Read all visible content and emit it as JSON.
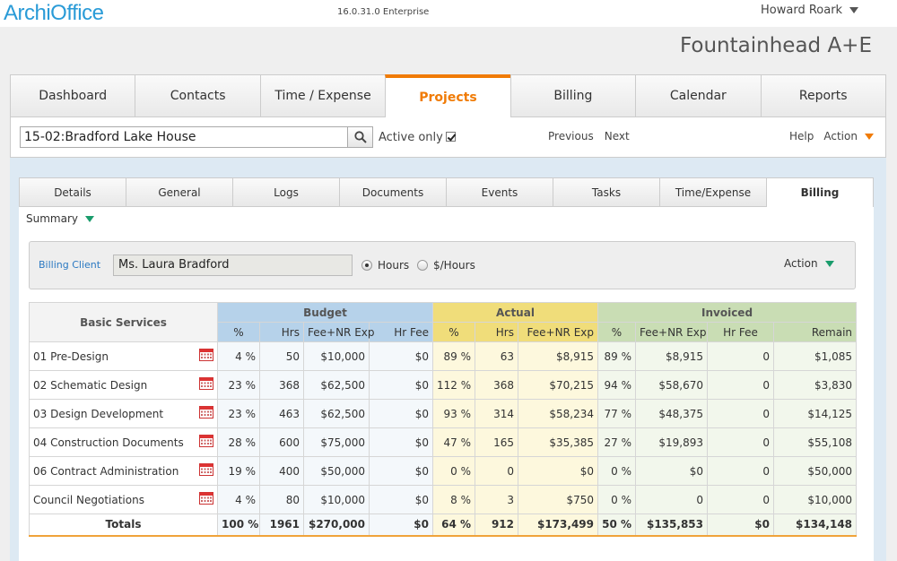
{
  "header": {
    "logo": "ArchiOffice",
    "version": "16.0.31.0 Enterprise",
    "user": "Howard Roark",
    "firm": "Fountainhead A+E"
  },
  "main_tabs": [
    "Dashboard",
    "Contacts",
    "Time / Expense",
    "Projects",
    "Billing",
    "Calendar",
    "Reports"
  ],
  "project_bar": {
    "project_value": "15-02:Bradford Lake House",
    "active_only_label": "Active only",
    "previous_label": "Previous",
    "next_label": "Next",
    "help_label": "Help",
    "action_label": "Action"
  },
  "sub_tabs": [
    "Details",
    "General",
    "Logs",
    "Documents",
    "Events",
    "Tasks",
    "Time/Expense",
    "Billing"
  ],
  "summary_label": "Summary",
  "client": {
    "label": "Billing Client",
    "value": "Ms. Laura Bradford",
    "hours_label": "Hours",
    "rate_label": "$/Hours",
    "action_label": "Action"
  },
  "table": {
    "col_basic": "Basic Services",
    "group_budget": "Budget",
    "group_actual": "Actual",
    "group_invoiced": "Invoiced",
    "sub_headers": [
      "%",
      "Hrs",
      "Fee+NR Exp",
      "Hr Fee",
      "%",
      "Hrs",
      "Fee+NR Exp",
      "%",
      "Fee+NR Exp",
      "Hr Fee",
      "Remain"
    ],
    "rows": [
      {
        "name": "01 Pre-Design",
        "cells": [
          "4 %",
          "50",
          "$10,000",
          "$0",
          "89 %",
          "63",
          "$8,915",
          "89 %",
          "$8,915",
          "0",
          "$1,085"
        ]
      },
      {
        "name": "02 Schematic Design",
        "cells": [
          "23 %",
          "368",
          "$62,500",
          "$0",
          "112 %",
          "368",
          "$70,215",
          "94 %",
          "$58,670",
          "0",
          "$3,830"
        ]
      },
      {
        "name": "03 Design Development",
        "cells": [
          "23 %",
          "463",
          "$62,500",
          "$0",
          "93 %",
          "314",
          "$58,234",
          "77 %",
          "$48,375",
          "0",
          "$14,125"
        ]
      },
      {
        "name": "04 Construction Documents",
        "cells": [
          "28 %",
          "600",
          "$75,000",
          "$0",
          "47 %",
          "165",
          "$35,385",
          "27 %",
          "$19,893",
          "0",
          "$55,108"
        ]
      },
      {
        "name": "06 Contract Administration",
        "cells": [
          "19 %",
          "400",
          "$50,000",
          "$0",
          "0 %",
          "0",
          "$0",
          "0 %",
          "$0",
          "0",
          "$50,000"
        ]
      },
      {
        "name": "Council Negotiations",
        "cells": [
          "4 %",
          "80",
          "$10,000",
          "$0",
          "8 %",
          "3",
          "$750",
          "0 %",
          "0",
          "0",
          "$10,000"
        ]
      }
    ],
    "totals": {
      "name": "Totals",
      "cells": [
        "100 %",
        "1961",
        "$270,000",
        "$0",
        "64 %",
        "912",
        "$173,499",
        "50 %",
        "$135,853",
        "$0",
        "$134,148"
      ]
    }
  },
  "colors": {
    "accent_orange": "#f07b05",
    "logo_blue": "#2a9bd7",
    "budget_header": "#b6d2ea",
    "actual_header": "#f0dd7a",
    "invoiced_header": "#c9ddb4"
  }
}
